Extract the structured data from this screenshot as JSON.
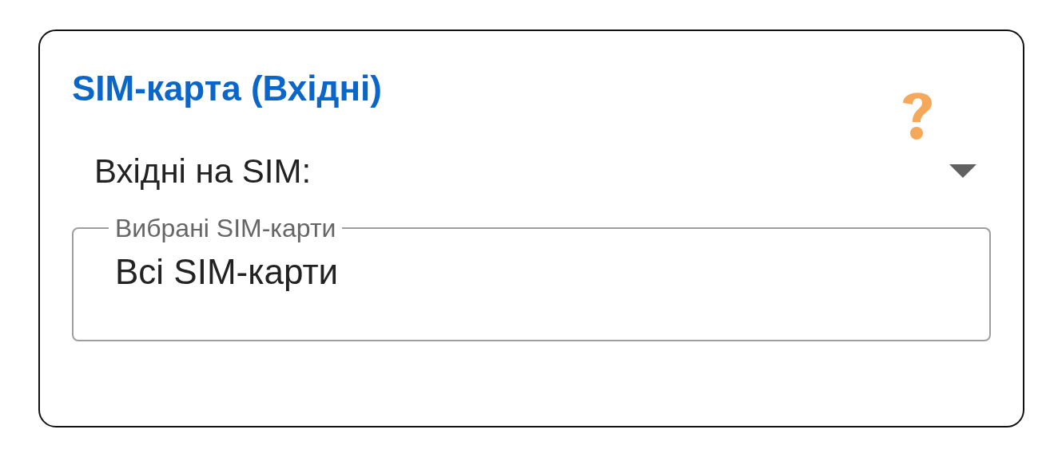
{
  "card": {
    "title": "SIM-карта (Вхідні)"
  },
  "dropdown": {
    "label": "Вхідні на SIM:"
  },
  "field": {
    "label": "Вибрані SIM-карти",
    "value": "Всі SIM-карти"
  }
}
